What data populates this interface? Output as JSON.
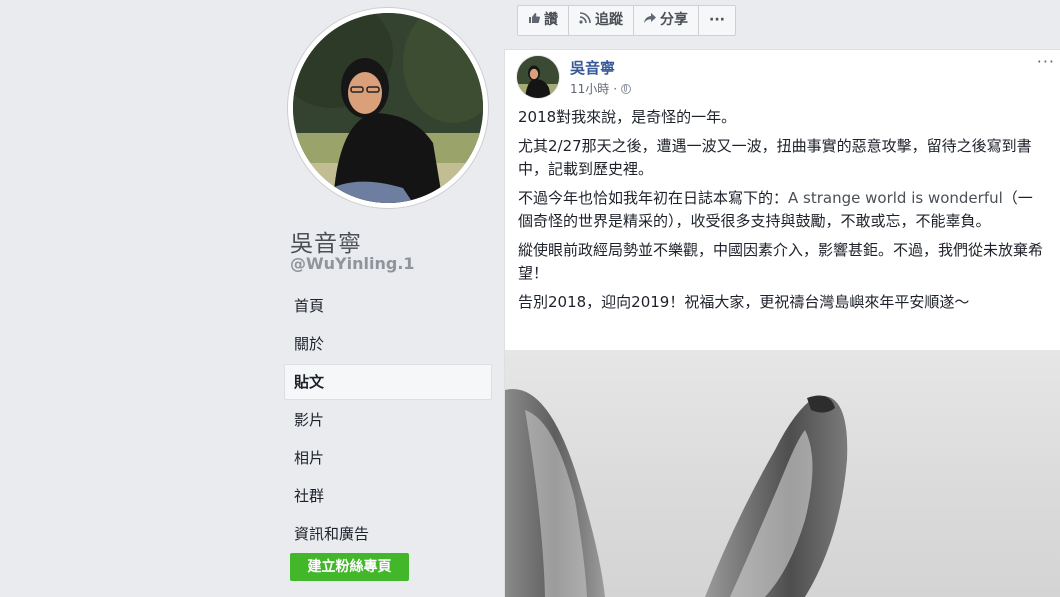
{
  "page": {
    "name": "吳音寧",
    "handle": "@WuYinling.1"
  },
  "nav": {
    "items": [
      {
        "label": "首頁",
        "active": false
      },
      {
        "label": "關於",
        "active": false
      },
      {
        "label": "貼文",
        "active": true
      },
      {
        "label": "影片",
        "active": false
      },
      {
        "label": "相片",
        "active": false
      },
      {
        "label": "社群",
        "active": false
      },
      {
        "label": "資訊和廣告",
        "active": false
      }
    ],
    "create_button": "建立粉絲專頁"
  },
  "actions": {
    "like": {
      "label": "讚",
      "icon": "thumbs-up-icon"
    },
    "follow": {
      "label": "追蹤",
      "icon": "rss-icon"
    },
    "share": {
      "label": "分享",
      "icon": "share-arrow-icon"
    },
    "more": {
      "label": "···"
    }
  },
  "post": {
    "author": "吳音寧",
    "time": "11小時",
    "privacy_icon": "globe-icon",
    "more_label": "···",
    "paragraphs": {
      "p1": "2018對我來說，是奇怪的一年。",
      "p2": "尤其2/27那天之後，遭遇一波又一波，扭曲事實的惡意攻擊，留待之後寫到書中，記載到歷史裡。",
      "p3_a": "不過今年也恰如我年初在日誌本寫下的：",
      "p3_en": "A strange world is wonderful",
      "p3_b": "（一個奇怪的世界是精采的），收受很多支持與鼓勵，不敢或忘，不能辜負。",
      "p4": "縱使眼前政經局勢並不樂觀，中國因素介入，影響甚鉅。不過，我們從未放棄希望！",
      "p5": "告別2018，迎向2019！祝福大家，更祝禱台灣島嶼來年平安順遂～"
    },
    "image_subject": "rabbit-ears-drawing"
  },
  "colors": {
    "background": "#e9ebee",
    "link_blue": "#365899",
    "create_green": "#42b72a"
  }
}
